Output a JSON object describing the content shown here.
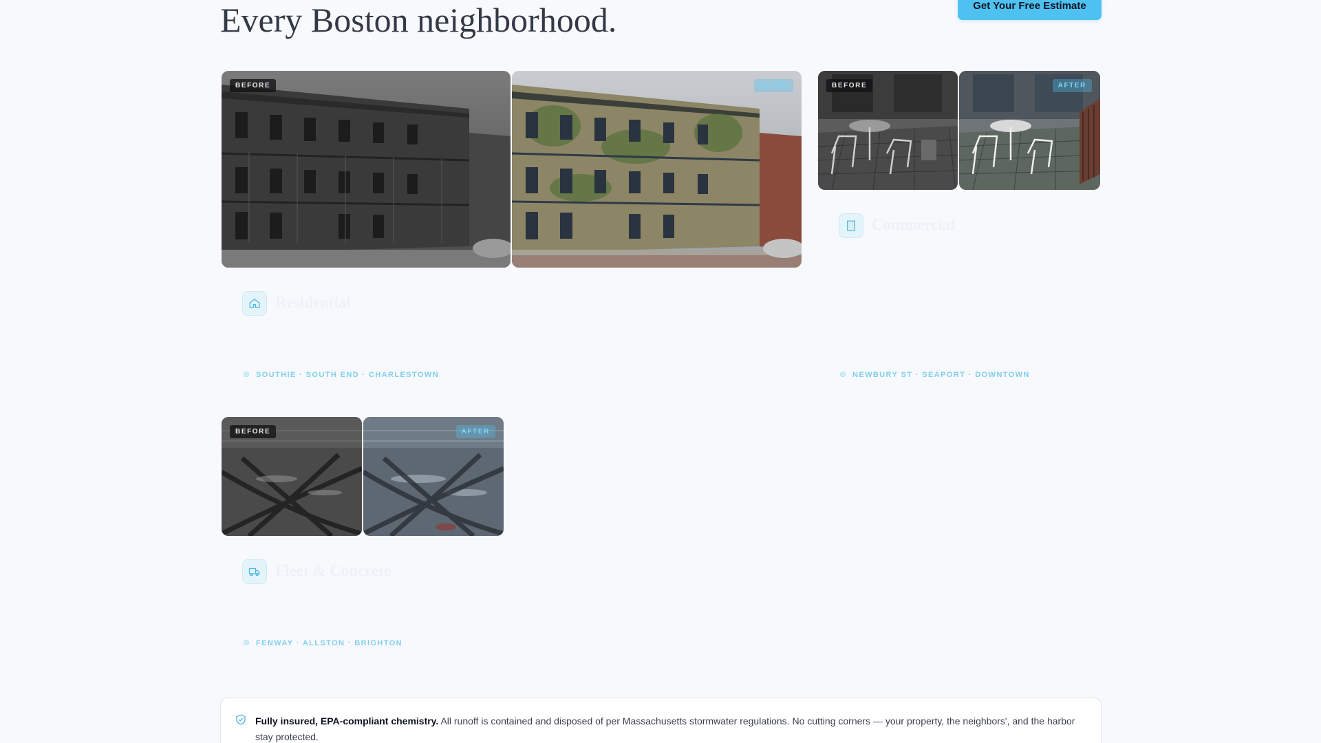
{
  "heading": {
    "line1": "Every Boston neighborhood.",
    "line2": "Every Boston neighborhood."
  },
  "cta": {
    "label": "Get Your Free Estimate"
  },
  "badges": {
    "before": "BEFORE",
    "after": "AFTER"
  },
  "cards": [
    {
      "id": "residential",
      "title": "Residential",
      "icon": "house-icon",
      "description": "",
      "areas": "SOUTHIE · SOUTH END · CHARLESTOWN"
    },
    {
      "id": "commercial",
      "title": "Commercial",
      "icon": "building-icon",
      "description": "",
      "areas": "NEWBURY ST · SEAPORT · DOWNTOWN"
    },
    {
      "id": "fleet",
      "title": "Fleet & Concrete",
      "icon": "truck-icon",
      "description": "",
      "areas": "FENWAY · ALLSTON · BRIGHTON"
    }
  ],
  "note": {
    "bold": "Fully insured, EPA-compliant chemistry.",
    "text": " All runoff is contained and disposed of per Massachusetts stormwater regulations. No cutting corners — your property, the neighbors', and the harbor stay protected."
  },
  "colors": {
    "accent": "#4fc1f0",
    "background": "#f8f9fc",
    "heading": "#333a46"
  }
}
